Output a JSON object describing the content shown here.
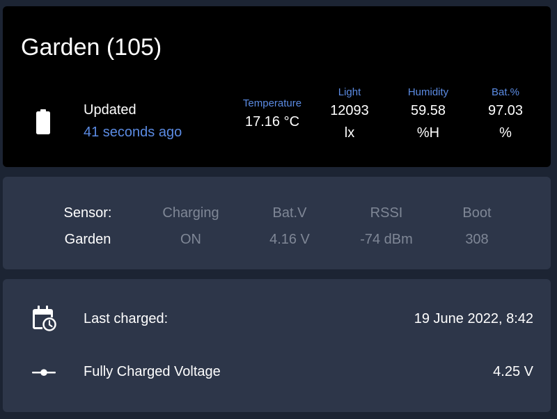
{
  "header": {
    "title": "Garden (105)",
    "updated_label": "Updated",
    "updated_time": "41 seconds ago",
    "battery_icon": "battery-full-icon"
  },
  "metrics": {
    "temperature": {
      "label": "Temperature",
      "value": "17.16 °C"
    },
    "light": {
      "label": "Light",
      "value": "12093",
      "unit": "lx"
    },
    "humidity": {
      "label": "Humidity",
      "value": "59.58",
      "unit": "%H"
    },
    "battery": {
      "label": "Bat.%",
      "value": "97.03",
      "unit": "%"
    }
  },
  "sensor": {
    "columns": [
      {
        "header": "Sensor:",
        "value": "Garden"
      },
      {
        "header": "Charging",
        "value": "ON"
      },
      {
        "header": "Bat.V",
        "value": "4.16 V"
      },
      {
        "header": "RSSI",
        "value": "-74 dBm"
      },
      {
        "header": "Boot",
        "value": "308"
      }
    ]
  },
  "info": {
    "rows": [
      {
        "icon": "calendar-clock-icon",
        "label": "Last charged:",
        "value": "19 June 2022, 8:42"
      },
      {
        "icon": "voltage-icon",
        "label": "Fully Charged Voltage",
        "value": "4.25 V"
      }
    ]
  },
  "colors": {
    "background": "#1c2433",
    "card_dark": "#000000",
    "card": "#2d3649",
    "accent": "#5b8be3",
    "text": "#ffffff",
    "muted": "#7f8796"
  }
}
